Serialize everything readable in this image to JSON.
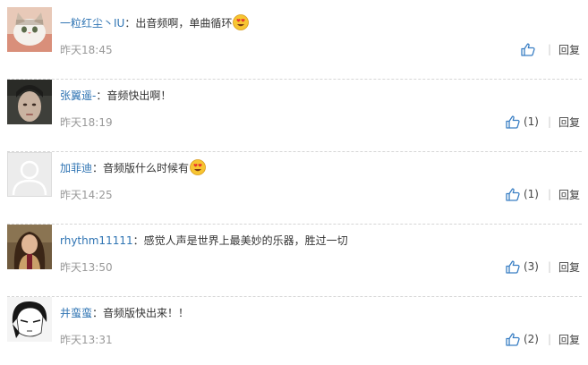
{
  "comments": [
    {
      "username": "一粒红尘丶IU",
      "text": "：出音频啊，单曲循环",
      "emoji": "smiling-heart-eyes-emoji",
      "time": "昨天18:45",
      "like_count": "",
      "reply_label": "回复"
    },
    {
      "username": "张翼遥-",
      "text": "：音频快出啊！",
      "emoji": "",
      "time": "昨天18:19",
      "like_count": "(1)",
      "reply_label": "回复"
    },
    {
      "username": "加菲迪",
      "text": "：音频版什么时候有",
      "emoji": "smiling-heart-eyes-emoji",
      "time": "昨天14:25",
      "like_count": "(1)",
      "reply_label": "回复"
    },
    {
      "username": "rhythm11111",
      "text": "：感觉人声是世界上最美妙的乐器，胜过一切",
      "emoji": "",
      "time": "昨天13:50",
      "like_count": "(3)",
      "reply_label": "回复"
    },
    {
      "username": "井蛮蛮",
      "text": "：音频版快出来！！",
      "emoji": "",
      "time": "昨天13:31",
      "like_count": "(2)",
      "reply_label": "回复"
    }
  ],
  "colors": {
    "username": "#2f74b3",
    "time": "#999999",
    "like_icon": "#3a7fc4",
    "separator": "#d6d6d6"
  }
}
